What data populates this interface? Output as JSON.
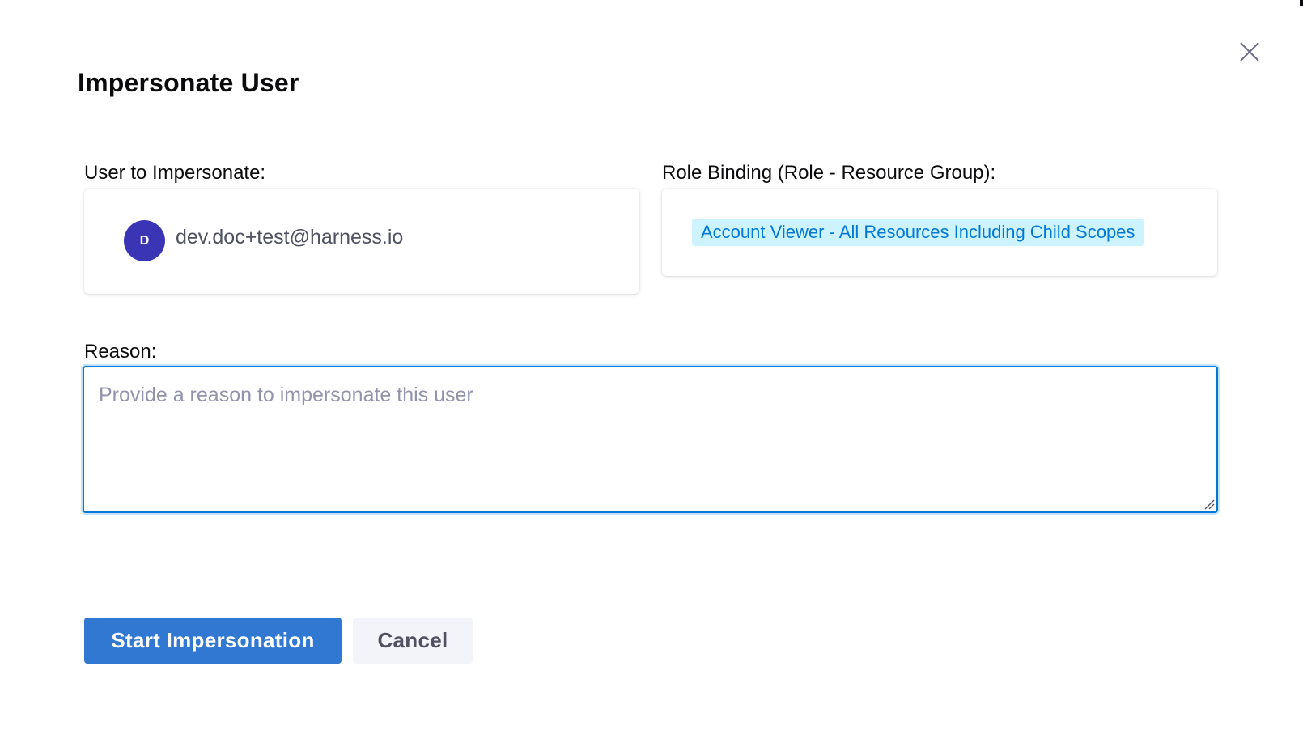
{
  "dialog": {
    "title": "Impersonate User",
    "close_icon": "close-icon"
  },
  "user_section": {
    "label": "User to Impersonate:",
    "avatar_initial": "D",
    "avatar_color": "#3a35b4",
    "email": "dev.doc+test@harness.io"
  },
  "role_section": {
    "label": "Role Binding (Role - Resource Group):",
    "tag": "Account Viewer - All Resources Including Child Scopes",
    "tag_bg": "#cdf4fe",
    "tag_color": "#0278d5"
  },
  "reason_section": {
    "label": "Reason:",
    "value": "",
    "placeholder": "Provide a reason to impersonate this user",
    "resize_icon": "resize-handle-icon"
  },
  "actions": {
    "primary_label": "Start Impersonation",
    "secondary_label": "Cancel",
    "primary_color": "#3078d2"
  }
}
